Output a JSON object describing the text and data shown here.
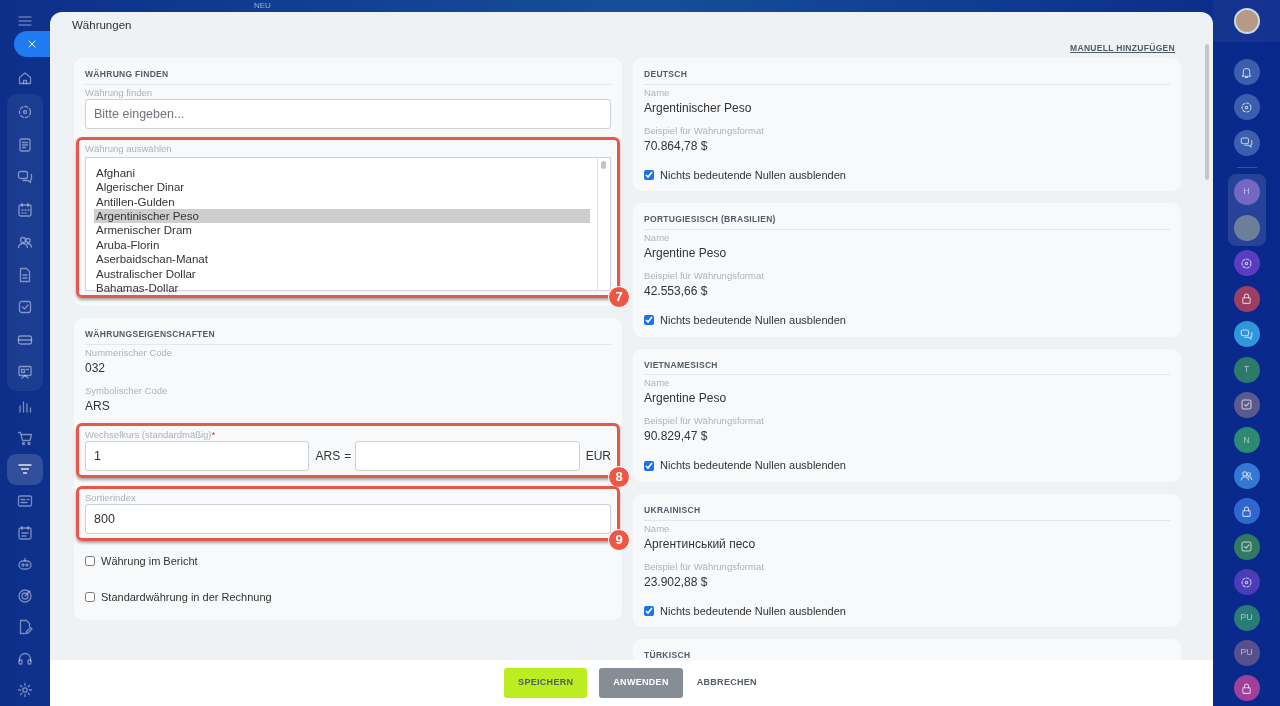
{
  "app": {
    "new_label": "NEU"
  },
  "window": {
    "title": "Währungen",
    "manual_add_link": "MANUELL HINZUFÜGEN"
  },
  "find_section": {
    "heading": "WÄHRUNG FINDEN",
    "search": {
      "label": "Währung finden",
      "placeholder": "Bitte eingeben..."
    },
    "select": {
      "label": "Währung auswählen",
      "callout": "7",
      "options": [
        {
          "label": "Afghani",
          "selected": false
        },
        {
          "label": "Algerischer Dinar",
          "selected": false
        },
        {
          "label": "Antillen-Gulden",
          "selected": false
        },
        {
          "label": "Argentinischer Peso",
          "selected": true
        },
        {
          "label": "Armenischer Dram",
          "selected": false
        },
        {
          "label": "Aruba-Florin",
          "selected": false
        },
        {
          "label": "Aserbaidschan-Manat",
          "selected": false
        },
        {
          "label": "Australischer Dollar",
          "selected": false
        },
        {
          "label": "Bahamas-Dollar",
          "selected": false
        }
      ]
    }
  },
  "properties": {
    "heading": "WÄHRUNGSEIGENSCHAFTEN",
    "numeric_code": {
      "label": "Nummerischer Code",
      "value": "032"
    },
    "symbolic_code": {
      "label": "Symbolischer Code",
      "value": "ARS"
    },
    "exchange_rate": {
      "label": "Wechselkurs (standardmäßig)",
      "required_mark": "*",
      "amount": "1",
      "currency": "ARS",
      "equals": "=",
      "target_currency": "EUR",
      "callout": "8"
    },
    "sort_index": {
      "label": "Sortierindex",
      "value": "800",
      "callout": "9"
    },
    "checkboxes": [
      {
        "label": "Währung im Bericht",
        "checked": false
      },
      {
        "label": "Standardwährung in der Rechnung",
        "checked": false
      }
    ]
  },
  "languages": [
    {
      "heading": "DEUTSCH",
      "name_label": "Name",
      "name": "Argentinischer Peso",
      "format_label": "Beispiel für Währungsformat",
      "format_example": "70.864,78 $",
      "hide_zeros": {
        "label": "Nichts bedeutende Nullen ausblenden",
        "checked": true
      }
    },
    {
      "heading": "PORTUGIESISCH (BRASILIEN)",
      "name_label": "Name",
      "name": "Argentine Peso",
      "format_label": "Beispiel für Währungsformat",
      "format_example": "42.553,66 $",
      "hide_zeros": {
        "label": "Nichts bedeutende Nullen ausblenden",
        "checked": true
      }
    },
    {
      "heading": "VIETNAMESISCH",
      "name_label": "Name",
      "name": "Argentine Peso",
      "format_label": "Beispiel für Währungsformat",
      "format_example": "90.829,47 $",
      "hide_zeros": {
        "label": "Nichts bedeutende Nullen ausblenden",
        "checked": true
      }
    },
    {
      "heading": "UKRAINISCH",
      "name_label": "Name",
      "name": "Аргентинський песо",
      "format_label": "Beispiel für Währungsformat",
      "format_example": "23.902,88 $",
      "hide_zeros": {
        "label": "Nichts bedeutende Nullen ausblenden",
        "checked": true
      }
    },
    {
      "heading": "TÜRKISCH"
    }
  ],
  "footer": {
    "buttons": [
      {
        "label": "SPEICHERN",
        "kind": "primary"
      },
      {
        "label": "ANWENDEN",
        "kind": "secondary"
      },
      {
        "label": "ABBRECHEN",
        "kind": "link"
      }
    ]
  },
  "right_rail": {
    "items": [
      {
        "kind": "bell",
        "color": "#3b5fae"
      },
      {
        "kind": "swirl",
        "color": "#3b5fae"
      },
      {
        "kind": "chat",
        "color": "#3b5fae"
      },
      {
        "kind": "letter",
        "label": "H",
        "color": "#7468c4"
      },
      {
        "kind": "photo",
        "color": "#6b7f99"
      },
      {
        "kind": "swirl",
        "color": "#5a3cc0"
      },
      {
        "kind": "lock",
        "color": "#9c3f63"
      },
      {
        "kind": "chat",
        "color": "#2e96dc"
      },
      {
        "kind": "letter",
        "label": "T",
        "color": "#2d7a6c"
      },
      {
        "kind": "check",
        "color": "#5b5a8c"
      },
      {
        "kind": "letter",
        "label": "N",
        "color": "#2c8a72"
      },
      {
        "kind": "people",
        "color": "#3577d4"
      },
      {
        "kind": "lock",
        "color": "#2f67cf"
      },
      {
        "kind": "check",
        "color": "#2f7a60"
      },
      {
        "kind": "swirl",
        "color": "#4b3cb8"
      },
      {
        "kind": "letter",
        "label": "PU",
        "color": "#2a7a78"
      },
      {
        "kind": "letter",
        "label": "PU",
        "color": "#57508c"
      },
      {
        "kind": "lock",
        "color": "#a03f9c"
      }
    ]
  }
}
